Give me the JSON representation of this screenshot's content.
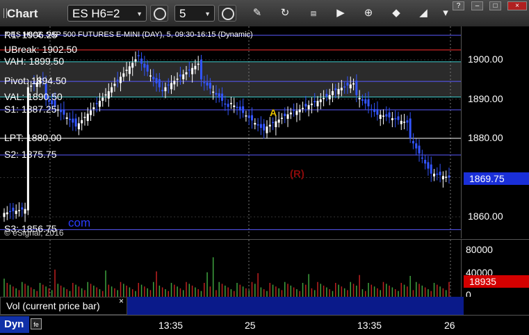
{
  "toolbar": {
    "title": "Chart",
    "symbol": "ES H6=2",
    "interval": "5",
    "icons": [
      "grid-icon",
      "crosshair-icon",
      "clock-icon",
      "pencil-icon",
      "refresh-icon",
      "get-icon",
      "play-icon",
      "eraser-icon",
      "tag-icon",
      "settings-icon"
    ],
    "window_buttons": [
      "?",
      "–",
      "□",
      "×"
    ]
  },
  "chart_header": "* ES H6=2, S&P 500 FUTURES E-MINI (DAY), 5, 09:30-16:15 (Dynamic)",
  "copyright": "© eSignal, 2016",
  "watermark": "com",
  "marker_r": "(R)",
  "marker_a": "A",
  "levels": [
    {
      "name": "R1",
      "label": "R1: 1906.25",
      "price": 1906.25,
      "color": "#5a5aff"
    },
    {
      "name": "UBreak",
      "label": "UBreak: 1902.50",
      "price": 1902.5,
      "color": "#ff3030"
    },
    {
      "name": "VAH",
      "label": "VAH: 1899.50",
      "price": 1899.5,
      "color": "#3fd0d0"
    },
    {
      "name": "Pivot",
      "label": "Pivot: 1894.50",
      "price": 1894.5,
      "color": "#5a5aff"
    },
    {
      "name": "VAL",
      "label": "VAL: 1890.50",
      "price": 1890.5,
      "color": "#3fd0d0"
    },
    {
      "name": "S1",
      "label": "S1: 1887.25",
      "price": 1887.25,
      "color": "#5a5aff"
    },
    {
      "name": "LPT",
      "label": "LPT: 1880.00",
      "price": 1880.0,
      "color": "#ffffff"
    },
    {
      "name": "S2",
      "label": "S2: 1875.75",
      "price": 1875.75,
      "color": "#5a5aff"
    },
    {
      "name": "S3",
      "label": "S3: 1856.75",
      "price": 1856.75,
      "color": "#5a5aff"
    }
  ],
  "price_axis": {
    "ticks": [
      "1900.00",
      "1890.00",
      "1880.00",
      "1870.00",
      "1860.00"
    ],
    "current_price": "1869.75",
    "current_color": "#1a2fd8"
  },
  "volume_axis": {
    "ticks": [
      "80000",
      "40000",
      "0"
    ],
    "current_volume": "18935",
    "current_color": "#d40000"
  },
  "volume_legend": "Vol (current price bar)",
  "volume_legend_close": "×",
  "time_axis": [
    "13:35",
    "25",
    "13:35",
    "26"
  ],
  "footer": {
    "dyn": "Dyn",
    "dyn_icon": "fe"
  },
  "chart_data": {
    "type": "candlestick",
    "title": "* ES H6=2, S&P 500 FUTURES E-MINI (DAY), 5, 09:30-16:15 (Dynamic)",
    "ylim": [
      1856,
      1908
    ],
    "y_ticks": [
      1900,
      1890,
      1880,
      1870,
      1860
    ],
    "x_ticks": [
      "13:35",
      "25",
      "13:35",
      "26"
    ],
    "last_price": 1869.75,
    "last_volume": 18935,
    "volume_ylim": [
      0,
      90000
    ],
    "volume_ticks": [
      80000,
      40000,
      0
    ]
  }
}
